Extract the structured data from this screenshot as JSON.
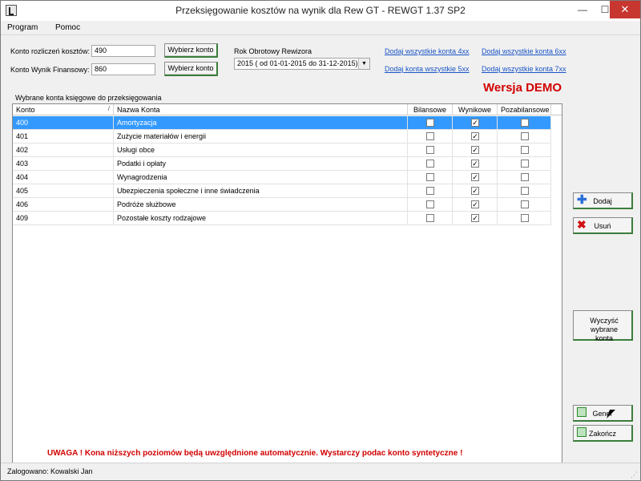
{
  "window": {
    "title": "Przeksięgowanie kosztów na wynik dla Rew GT - REWGT 1.37 SP2",
    "min_glyph": "—",
    "max_glyph": "☐",
    "close_glyph": "✕"
  },
  "menu": [
    "Program",
    "Pomoc"
  ],
  "form": {
    "konto_rozliczen_label": "Konto rozliczeń kosztów:",
    "konto_rozliczen_value": "490",
    "konto_wynik_label": "Konto Wynik Finansowy:",
    "konto_wynik_value": "860",
    "wybierz_konto_1": "Wybierz konto",
    "wybierz_konto_2": "Wybierz konto",
    "rok_label": "Rok Obrotowy Rewizora",
    "rok_value": "2015 ( od 01-01-2015 do 31-12-2015)"
  },
  "links": {
    "add_4xx": "Dodaj wszystkie konta 4xx",
    "add_6xx": "Dodaj wszystkie konta 6xx",
    "add_5xx": "Dodaj konta wszystkie 5xx",
    "add_7xx": "Dodaj wszystkie konta 7xx"
  },
  "demo_label": "Wersja DEMO",
  "grid": {
    "caption": "Wybrane konta księgowe do przeksięgowania",
    "columns": [
      "Konto",
      "Nazwa Konta",
      "Bilansowe",
      "Wynikowe",
      "Pozabilansowe"
    ],
    "sort_glyph": "/",
    "rows": [
      {
        "konto": "400",
        "nazwa": "Amortyzacja",
        "bilansowe": false,
        "wynikowe": true,
        "pozabilansowe": false,
        "selected": true
      },
      {
        "konto": "401",
        "nazwa": "Zużycie materiałów i energii",
        "bilansowe": false,
        "wynikowe": true,
        "pozabilansowe": false
      },
      {
        "konto": "402",
        "nazwa": "Usługi obce",
        "bilansowe": false,
        "wynikowe": true,
        "pozabilansowe": false
      },
      {
        "konto": "403",
        "nazwa": "Podatki i opłaty",
        "bilansowe": false,
        "wynikowe": true,
        "pozabilansowe": false
      },
      {
        "konto": "404",
        "nazwa": "Wynagrodzenia",
        "bilansowe": false,
        "wynikowe": true,
        "pozabilansowe": false
      },
      {
        "konto": "405",
        "nazwa": "Ubezpieczenia społeczne i inne świadczenia",
        "bilansowe": false,
        "wynikowe": true,
        "pozabilansowe": false
      },
      {
        "konto": "406",
        "nazwa": "Podróże służbowe",
        "bilansowe": false,
        "wynikowe": true,
        "pozabilansowe": false
      },
      {
        "konto": "409",
        "nazwa": "Pozostałe koszty rodzajowe",
        "bilansowe": false,
        "wynikowe": true,
        "pozabilansowe": false
      }
    ]
  },
  "buttons": {
    "dodaj": "Dodaj",
    "usun": "Usuń",
    "wyczysc": "Wyczyść wybrane konta",
    "generuj": "Gener",
    "zakoncz": "Zakończ"
  },
  "warning": "UWAGA ! Kona niższych poziomów będą uwzględnione automatycznie. Wystarczy podac konto syntetyczne !",
  "status": "Zalogowano: Kowalski Jan",
  "colors": {
    "selection": "#3399ff",
    "warning_red": "#d20000",
    "link_blue": "#1a55c7",
    "close_red": "#c7372f",
    "button_edge_green": "#3b7d3b"
  }
}
